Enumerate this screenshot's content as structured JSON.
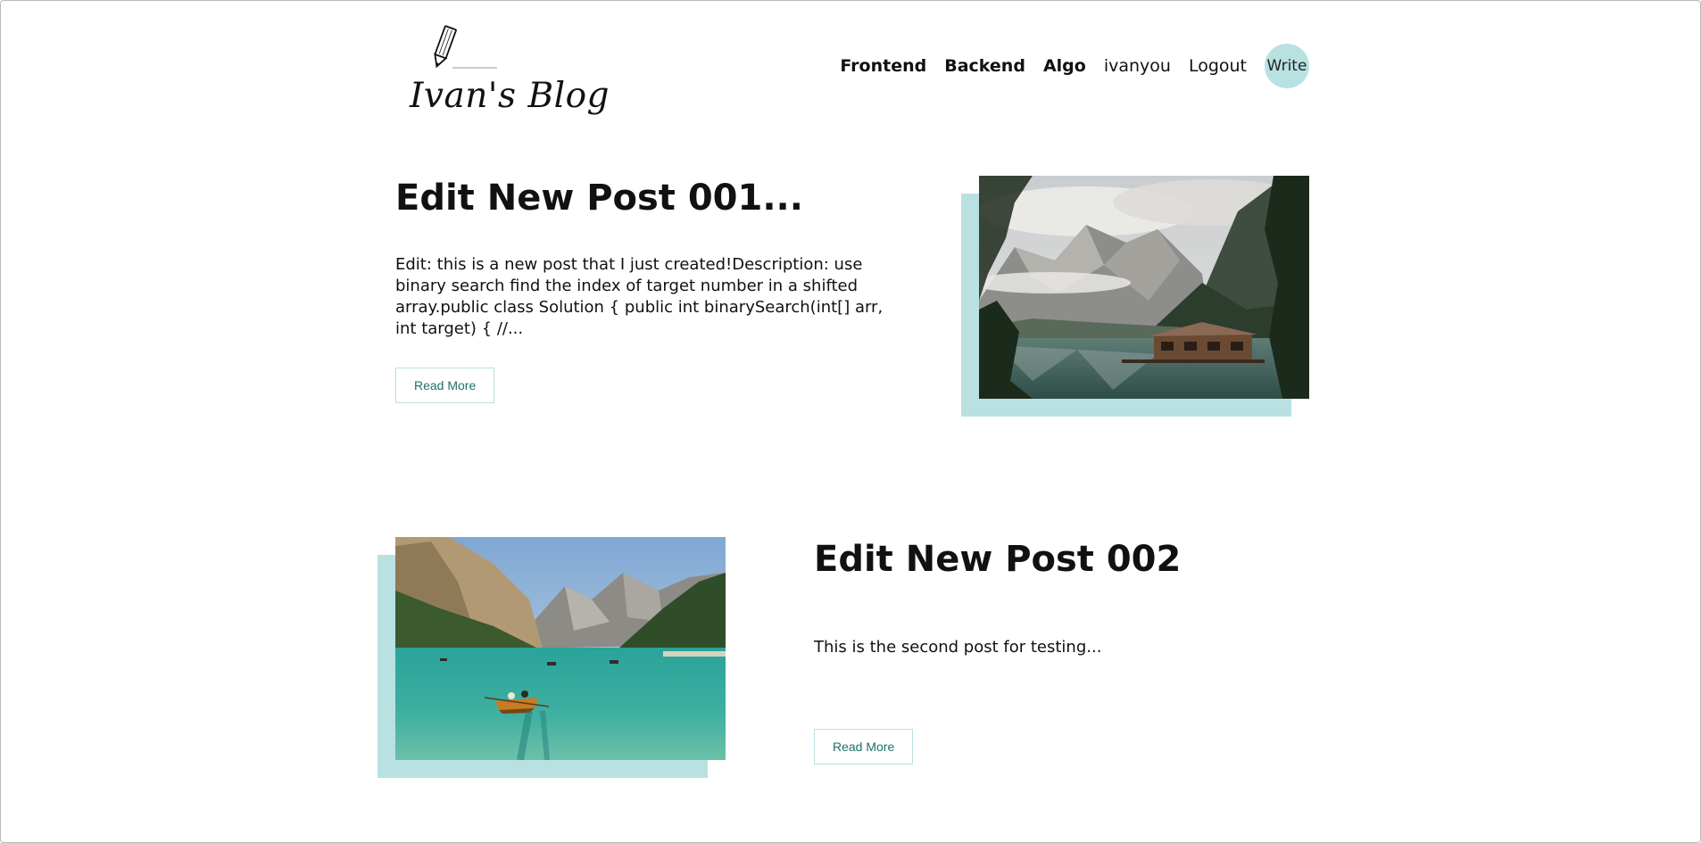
{
  "navbar": {
    "logo_text": "Ivan's Blog",
    "links": [
      {
        "label": "Frontend"
      },
      {
        "label": "Backend"
      },
      {
        "label": "Algo"
      },
      {
        "label": "ivanyou"
      },
      {
        "label": "Logout"
      }
    ],
    "write_label": "Write"
  },
  "posts": [
    {
      "title": "Edit New Post 001...",
      "description": "Edit: this is a new post that I just created!Description: use binary search find the index of target number in a shifted array.public class Solution { public int binarySearch(int[] arr, int target) { //...",
      "read_more_label": "Read More",
      "image_subject": "mountain-lake-boathouse"
    },
    {
      "title": "Edit New Post 002",
      "description": "This is the second post for testing...",
      "read_more_label": "Read More",
      "image_subject": "turquoise-lake-rowboat"
    }
  ],
  "colors": {
    "accent": "#b9e1e1",
    "button_text": "#1e6f6f",
    "text": "#111111"
  }
}
